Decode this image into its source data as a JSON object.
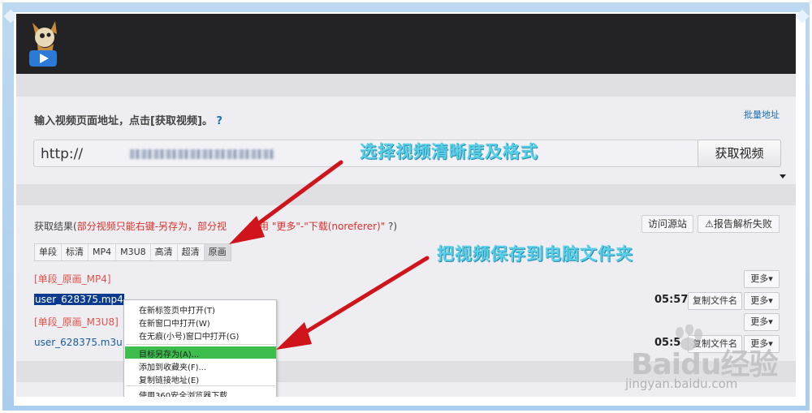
{
  "main": {
    "input_label": "输入视频页面地址，点击[获取视频]。",
    "help": "?",
    "batch_link": "批量地址",
    "url_prefix": "http://",
    "get_video_button": "获取视频"
  },
  "results": {
    "label": "获取结果(",
    "note_part1": "部分视频只能右键-另存为，部分视",
    "note_part2": "用 \"更多\"-\"下载(noreferer)\"",
    "note_end": "?)",
    "visit_source_button": "访问源站",
    "report_button": "报告解析失败",
    "warning_glyph": "⚠"
  },
  "tabs": [
    "单段",
    "标清",
    "MP4",
    "M3U8",
    "高清",
    "超清",
    "原画"
  ],
  "files": [
    {
      "section": "[单段_原画_MP4]",
      "name": "user_628375.mp4",
      "duration": "05:57"
    },
    {
      "section": "[单段_原画_M3U8]",
      "name": "user_628375.m3u",
      "duration": "05:5"
    }
  ],
  "buttons": {
    "more": "更多▾",
    "copy_name": "复制文件名"
  },
  "context_menu": [
    "在新标签页中打开(T)",
    "在新窗口中打开(W)",
    "在无痕(小号)窗口中打开(G)",
    "目标另存为(A)...",
    "添加到收藏夹(F)...",
    "复制链接地址(E)",
    "使用360安全浏览器下载"
  ],
  "annotations": {
    "select": "选择视频清晰度及格式",
    "save": "把视频保存到电脑文件夹"
  },
  "watermark": {
    "main": "Baidu经验",
    "sub": "jingyan.baidu.com"
  },
  "colors": {
    "annotation": "#57cfe9",
    "arrow": "#d0141c",
    "highlight": "#3dbd4c",
    "link": "#1a5c9a",
    "section": "#e0534b"
  }
}
